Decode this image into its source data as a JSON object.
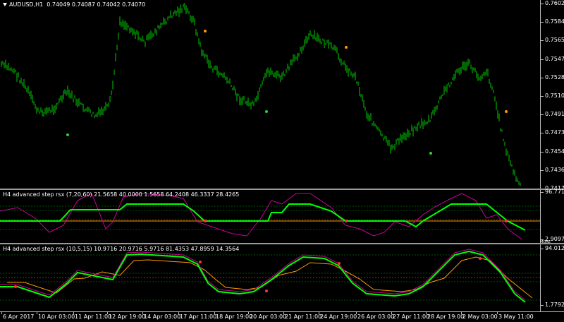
{
  "main_pane": {
    "symbol": "AUDUSD,H1",
    "quote": "0.74049 0.74087 0.74042 0.74070",
    "price_ticks": [
      "0.76025",
      "0.75840",
      "0.75655",
      "0.75470",
      "0.75285",
      "0.75100",
      "0.74915",
      "0.74730",
      "0.74545",
      "0.74360",
      "0.74175"
    ]
  },
  "indicator1": {
    "title": "H4 advanced step rsx (7,20,60) 21.5658 40.0000 1.5658 64.2408 46.3337 28.4265",
    "axis_top": "96.7718",
    "axis_bottom": "2.9097",
    "axis_bottom_small": "MORE"
  },
  "indicator2": {
    "title": "H4 advanced step rsx (10,5,15) 10.9716 20.9716 5.9716 81.4353 47.8959 14.3564",
    "axis_top": "94.0126",
    "axis_bottom": "1.7792"
  },
  "time_axis": [
    "6 Apr 2017",
    "10 Apr 03:00",
    "11 Apr 11:00",
    "12 Apr 19:00",
    "14 Apr 03:00",
    "17 Apr 11:00",
    "18 Apr 19:00",
    "20 Apr 03:00",
    "21 Apr 11:00",
    "24 Apr 19:00",
    "26 Apr 03:00",
    "27 Apr 11:00",
    "28 Apr 19:00",
    "2 May 03:00",
    "3 May 11:00"
  ],
  "colors": {
    "candle": "#00cc00",
    "dot_orange": "#ff9900",
    "dot_green": "#33cc33",
    "line_green": "#00ff00",
    "line_magenta": "#cc0099",
    "line_orange": "#ff9900",
    "grid_dash_green": "#00aa00",
    "grid_dash_orange": "#cc8800",
    "marker_red": "#ff3333"
  }
}
